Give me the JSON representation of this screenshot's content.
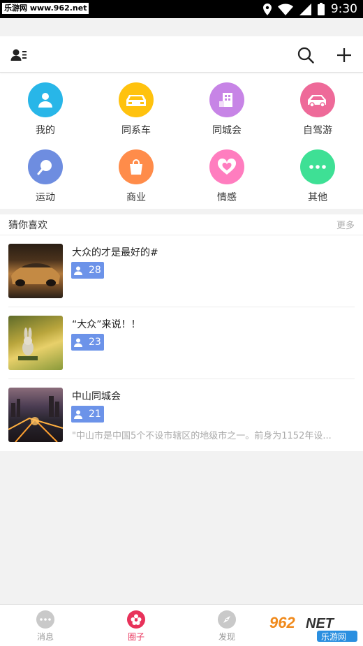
{
  "status_bar": {
    "watermark": "乐游网 www.962.net",
    "time": "9:30"
  },
  "grid": [
    {
      "label": "我的",
      "icon": "person-icon",
      "color": "#28b6e8"
    },
    {
      "label": "同系车",
      "icon": "car-icon",
      "color": "#ffc20e"
    },
    {
      "label": "同城会",
      "icon": "building-icon",
      "color": "#c784e6"
    },
    {
      "label": "自驾游",
      "icon": "taxi-icon",
      "color": "#ee6a99"
    },
    {
      "label": "运动",
      "icon": "racket-icon",
      "color": "#6e8de0"
    },
    {
      "label": "商业",
      "icon": "shopping-bag-icon",
      "color": "#ff8c4a"
    },
    {
      "label": "情感",
      "icon": "heart-icon",
      "color": "#ff7dbf"
    },
    {
      "label": "其他",
      "icon": "more-dots-icon",
      "color": "#3ee095"
    }
  ],
  "section": {
    "title": "猜你喜欢",
    "more": "更多",
    "items": [
      {
        "title": "大众的才是最好的#",
        "members": "28",
        "desc": ""
      },
      {
        "title": "“大众”来说！！",
        "members": "23",
        "desc": ""
      },
      {
        "title": "中山同城会",
        "members": "21",
        "desc": "\"中山市是中国5个不设市辖区的地级市之一。前身为1152年设..."
      }
    ]
  },
  "bottom_nav": [
    {
      "label": "消息",
      "icon": "chat-bubble-icon",
      "active": false
    },
    {
      "label": "圈子",
      "icon": "circle-flower-icon",
      "active": true
    },
    {
      "label": "发现",
      "icon": "compass-icon",
      "active": false
    }
  ],
  "accent_color": "#e8325a",
  "badge_color": "#6c93e9",
  "corner_watermark": {
    "big": "962NET",
    "small": "乐游网"
  }
}
